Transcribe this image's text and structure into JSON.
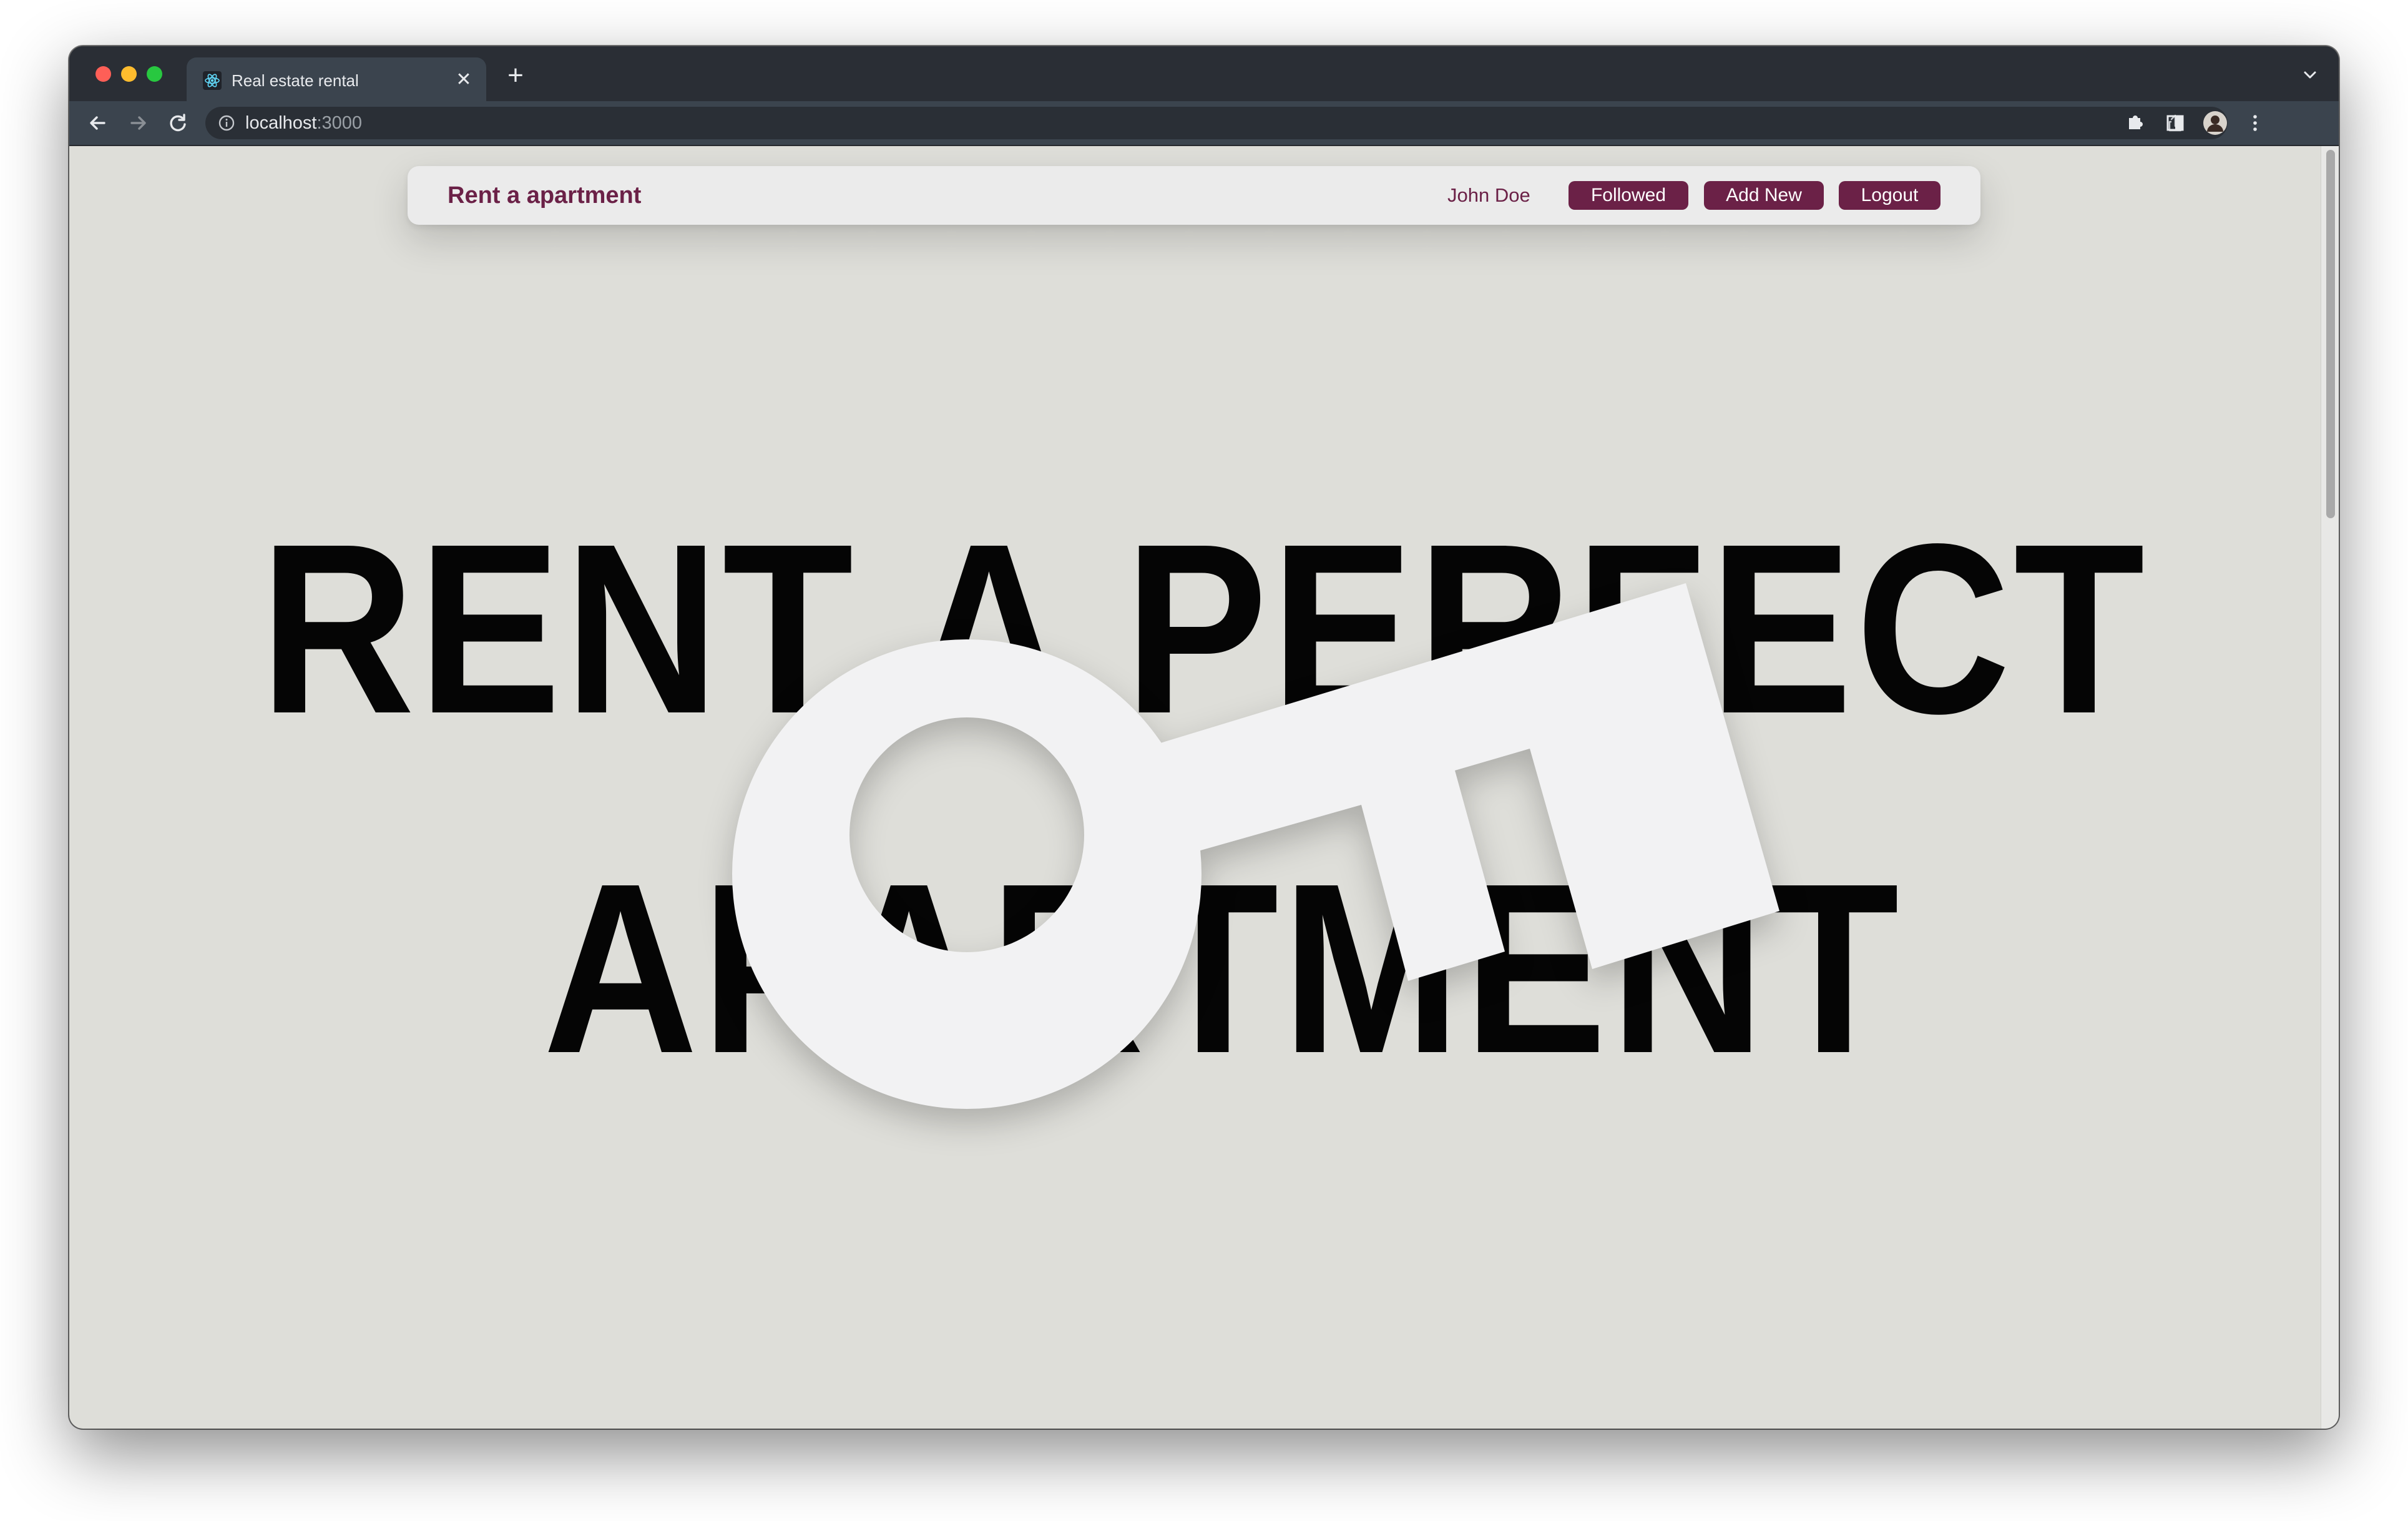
{
  "browser": {
    "tab": {
      "title": "Real estate rental",
      "favicon": "react-icon",
      "close_icon": "close-icon"
    },
    "new_tab_icon": "plus-icon",
    "address_bar": {
      "host": "localhost",
      "port": ":3000"
    },
    "toolbar_icons": [
      "back-arrow-icon",
      "forward-arrow-icon",
      "reload-icon",
      "info-icon",
      "share-icon",
      "star-icon",
      "extensions-icon",
      "side-panel-icon",
      "profile-avatar",
      "more-menu-icon"
    ]
  },
  "navbar": {
    "brand": "Rent a apartment",
    "username": "John Doe",
    "buttons": {
      "followed": "Followed",
      "add_new": "Add New",
      "logout": "Logout"
    }
  },
  "hero": {
    "line1": "RENT A PERFECT",
    "line2": "APARTMENT",
    "graphic": "key-icon"
  },
  "colors": {
    "brand": "#6b2147",
    "page_background": "#deded9",
    "navbar_background": "#ebebeb",
    "key": "#f2f2f3",
    "hero_text": "#050505"
  }
}
